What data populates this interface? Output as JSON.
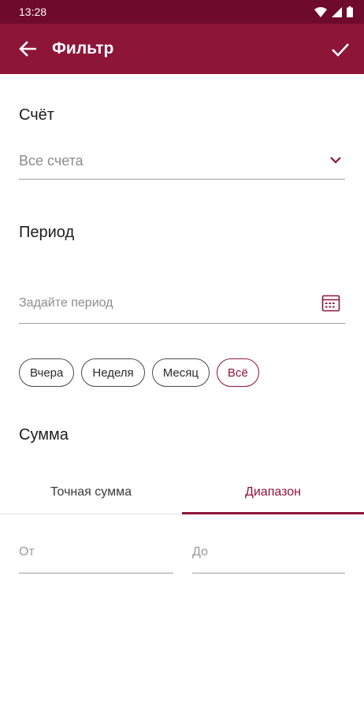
{
  "status_bar": {
    "time": "13:28",
    "icons": [
      "wifi-icon",
      "signal-icon",
      "battery-icon"
    ]
  },
  "app_bar": {
    "title": "Фильтр",
    "back_icon": "arrow-left-icon",
    "confirm_icon": "check-icon"
  },
  "account": {
    "title": "Счёт",
    "value": "Все счета",
    "dropdown_icon": "chevron-down-icon"
  },
  "period": {
    "title": "Период",
    "placeholder": "Задайте период",
    "calendar_icon": "calendar-icon",
    "chips": [
      {
        "label": "Вчера",
        "active": false
      },
      {
        "label": "Неделя",
        "active": false
      },
      {
        "label": "Месяц",
        "active": false
      },
      {
        "label": "Всё",
        "active": true
      }
    ]
  },
  "amount": {
    "title": "Сумма",
    "tabs": [
      {
        "label": "Точная сумма",
        "active": false
      },
      {
        "label": "Диапазон",
        "active": true
      }
    ],
    "from_placeholder": "От",
    "to_placeholder": "До"
  },
  "colors": {
    "status_bar": "#6e0a2b",
    "app_bar": "#8d1538",
    "accent": "#8d1538"
  }
}
